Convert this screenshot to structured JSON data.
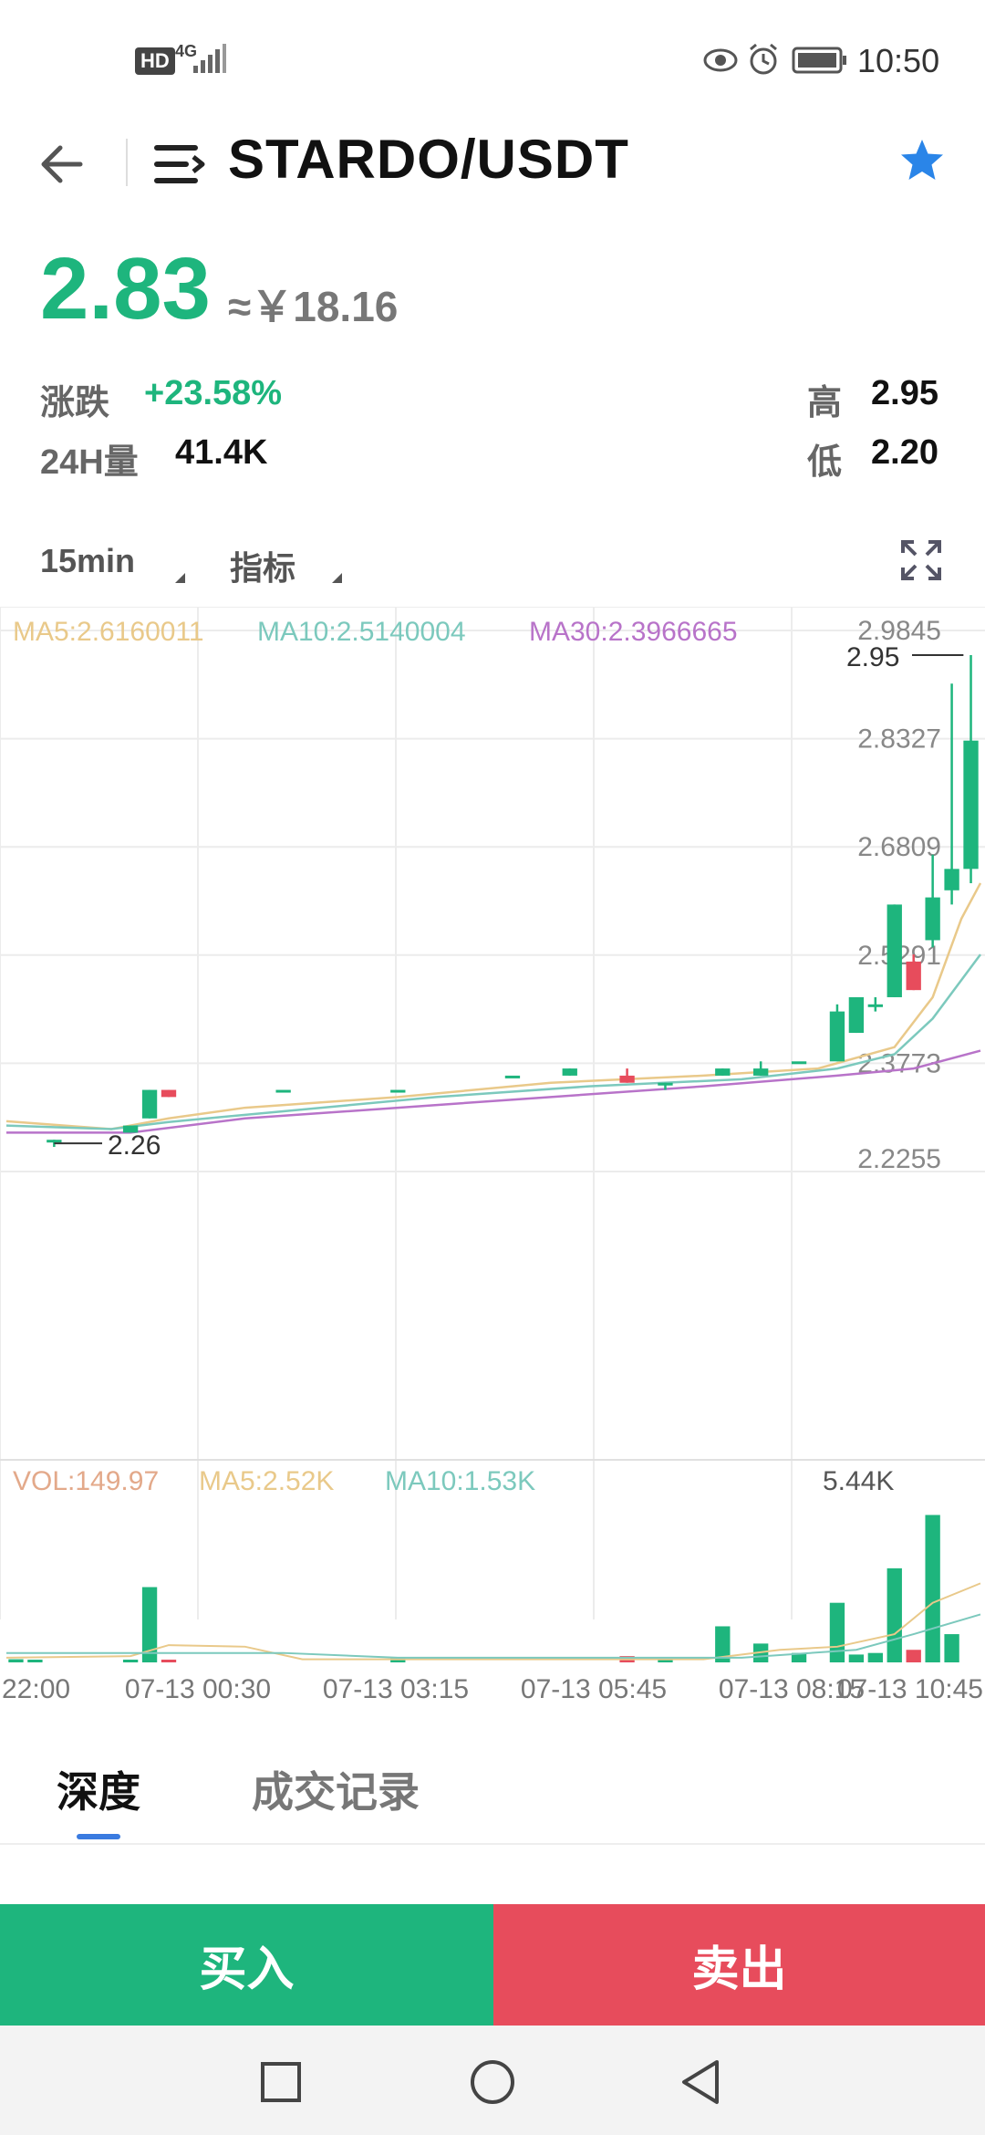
{
  "status_bar": {
    "network_left": "HD",
    "network_type": "4G",
    "time": "10:50",
    "icons": [
      "eye-icon",
      "alarm-icon",
      "battery-icon",
      "signal-icon"
    ]
  },
  "header": {
    "pair": "STARDO/USDT",
    "icons": [
      "back-arrow-icon",
      "menu-icon",
      "star-icon"
    ],
    "star_color": "#2a85e8"
  },
  "price": {
    "last": "2.83",
    "cny": "≈￥18.16",
    "change_label": "涨跌",
    "change_value": "+23.58%",
    "volume_label": "24H量",
    "volume_value": "41.4K",
    "high_label": "高",
    "high_value": "2.95",
    "low_label": "低",
    "low_value": "2.20"
  },
  "toolbar": {
    "interval": "15min",
    "indicator": "指标",
    "fullscreen_icon": "fullscreen-icon"
  },
  "chart_data": {
    "type": "candlestick",
    "ma_line": {
      "ma5": "MA5:2.6160011",
      "ma10": "MA10:2.5140004",
      "ma30": "MA30:2.3966665"
    },
    "y_ticks": [
      "2.9845",
      "2.8327",
      "2.6809",
      "2.5291",
      "2.3773",
      "2.2255"
    ],
    "ylim": [
      2.2255,
      2.9845
    ],
    "high_marker": "2.95",
    "low_marker": "2.26",
    "x_ticks": [
      "22:00",
      "07-13 00:30",
      "07-13 03:15",
      "07-13 05:45",
      "07-13 08:15",
      "07-13 10:45"
    ],
    "volume": {
      "label": "VOL:149.97",
      "ma5": "MA5:2.52K",
      "ma10": "MA10:1.53K",
      "max": "5.44K"
    },
    "colors": {
      "up": "#1eb57d",
      "down": "#e74c5c",
      "ma5": "#e9c98a",
      "ma10": "#7cc9bd",
      "ma30": "#b873c9"
    },
    "candles": [
      {
        "i": 2,
        "o": 2.27,
        "c": 2.27,
        "h": 2.27,
        "l": 2.26
      },
      {
        "i": 6,
        "o": 2.28,
        "c": 2.29,
        "h": 2.29,
        "l": 2.28
      },
      {
        "i": 7,
        "o": 2.3,
        "c": 2.34,
        "h": 2.34,
        "l": 2.3
      },
      {
        "i": 8,
        "o": 2.34,
        "c": 2.33,
        "h": 2.34,
        "l": 2.33
      },
      {
        "i": 14,
        "o": 2.34,
        "c": 2.34,
        "h": 2.34,
        "l": 2.34
      },
      {
        "i": 20,
        "o": 2.34,
        "c": 2.34,
        "h": 2.34,
        "l": 2.34
      },
      {
        "i": 26,
        "o": 2.36,
        "c": 2.36,
        "h": 2.36,
        "l": 2.36
      },
      {
        "i": 29,
        "o": 2.36,
        "c": 2.37,
        "h": 2.37,
        "l": 2.36
      },
      {
        "i": 32,
        "o": 2.36,
        "c": 2.35,
        "h": 2.37,
        "l": 2.35
      },
      {
        "i": 34,
        "o": 2.35,
        "c": 2.35,
        "h": 2.35,
        "l": 2.34
      },
      {
        "i": 37,
        "o": 2.36,
        "c": 2.37,
        "h": 2.37,
        "l": 2.36
      },
      {
        "i": 39,
        "o": 2.36,
        "c": 2.37,
        "h": 2.38,
        "l": 2.36
      },
      {
        "i": 41,
        "o": 2.38,
        "c": 2.38,
        "h": 2.38,
        "l": 2.38
      },
      {
        "i": 43,
        "o": 2.38,
        "c": 2.45,
        "h": 2.46,
        "l": 2.38
      },
      {
        "i": 44,
        "o": 2.42,
        "c": 2.47,
        "h": 2.47,
        "l": 2.42
      },
      {
        "i": 45,
        "o": 2.46,
        "c": 2.46,
        "h": 2.47,
        "l": 2.45
      },
      {
        "i": 46,
        "o": 2.47,
        "c": 2.6,
        "h": 2.6,
        "l": 2.47
      },
      {
        "i": 47,
        "o": 2.52,
        "c": 2.48,
        "h": 2.53,
        "l": 2.48
      },
      {
        "i": 48,
        "o": 2.55,
        "c": 2.61,
        "h": 2.67,
        "l": 2.54
      },
      {
        "i": 49,
        "o": 2.62,
        "c": 2.65,
        "h": 2.91,
        "l": 2.6
      },
      {
        "i": 50,
        "o": 2.65,
        "c": 2.83,
        "h": 2.95,
        "l": 2.63
      }
    ],
    "volumes": [
      {
        "i": 0,
        "v": 0.1,
        "up": true
      },
      {
        "i": 1,
        "v": 0.05,
        "up": true
      },
      {
        "i": 6,
        "v": 0.08,
        "up": true
      },
      {
        "i": 7,
        "v": 2.4,
        "up": true
      },
      {
        "i": 8,
        "v": 0.08,
        "up": false
      },
      {
        "i": 20,
        "v": 0.15,
        "up": true
      },
      {
        "i": 32,
        "v": 0.2,
        "up": false
      },
      {
        "i": 34,
        "v": 0.05,
        "up": true
      },
      {
        "i": 37,
        "v": 1.15,
        "up": true
      },
      {
        "i": 39,
        "v": 0.6,
        "up": true
      },
      {
        "i": 41,
        "v": 0.3,
        "up": true
      },
      {
        "i": 43,
        "v": 1.9,
        "up": true
      },
      {
        "i": 44,
        "v": 0.25,
        "up": true
      },
      {
        "i": 45,
        "v": 0.3,
        "up": true
      },
      {
        "i": 46,
        "v": 3.0,
        "up": true
      },
      {
        "i": 47,
        "v": 0.4,
        "up": false
      },
      {
        "i": 48,
        "v": 4.7,
        "up": true
      },
      {
        "i": 49,
        "v": 0.9,
        "up": true
      }
    ]
  },
  "tabs": [
    {
      "label": "深度",
      "active": true
    },
    {
      "label": "成交记录",
      "active": false
    }
  ],
  "actions": {
    "buy": "买入",
    "sell": "卖出"
  },
  "nav": [
    "square-nav-icon",
    "circle-nav-icon",
    "triangle-back-nav-icon"
  ]
}
